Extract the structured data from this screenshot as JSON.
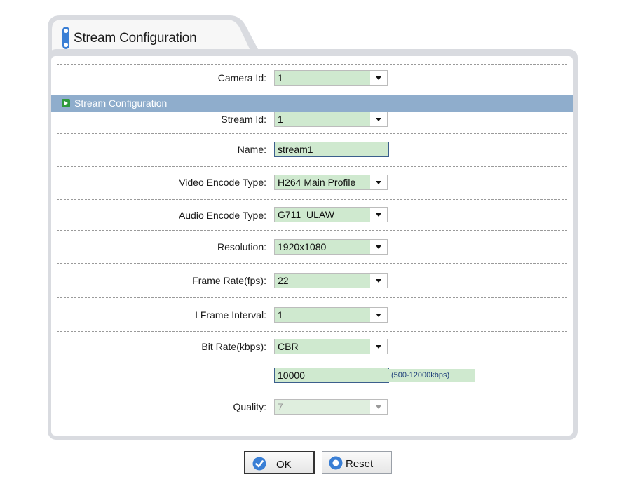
{
  "tab": {
    "title": "Stream Configuration"
  },
  "camera": {
    "label": "Camera Id:",
    "value": "1"
  },
  "section": {
    "title": "Stream Configuration"
  },
  "fields": {
    "stream_id": {
      "label": "Stream Id:",
      "value": "1"
    },
    "name": {
      "label": "Name:",
      "value": "stream1"
    },
    "video_encode": {
      "label": "Video Encode Type:",
      "value": "H264 Main Profile"
    },
    "audio_encode": {
      "label": "Audio Encode Type:",
      "value": "G711_ULAW"
    },
    "resolution": {
      "label": "Resolution:",
      "value": "1920x1080"
    },
    "frame_rate": {
      "label": "Frame Rate(fps):",
      "value": "22"
    },
    "i_frame": {
      "label": "I Frame Interval:",
      "value": "1"
    },
    "bit_rate": {
      "label": "Bit Rate(kbps):",
      "value": "CBR"
    },
    "bit_rate_value": {
      "value": "10000",
      "hint": "(500-12000kbps)"
    },
    "quality": {
      "label": "Quality:",
      "value": "7"
    }
  },
  "buttons": {
    "ok": "OK",
    "reset": "Reset"
  },
  "colors": {
    "field_bg": "#cfe9cf",
    "section_bar": "#8fadcc",
    "ok_icon": "#3a7fd5",
    "reset_icon": "#3a7fd5"
  },
  "icons": {
    "tab": "capsule-icon",
    "section": "expand-arrow-icon",
    "ok": "check-circle-icon",
    "reset": "ring-icon"
  }
}
